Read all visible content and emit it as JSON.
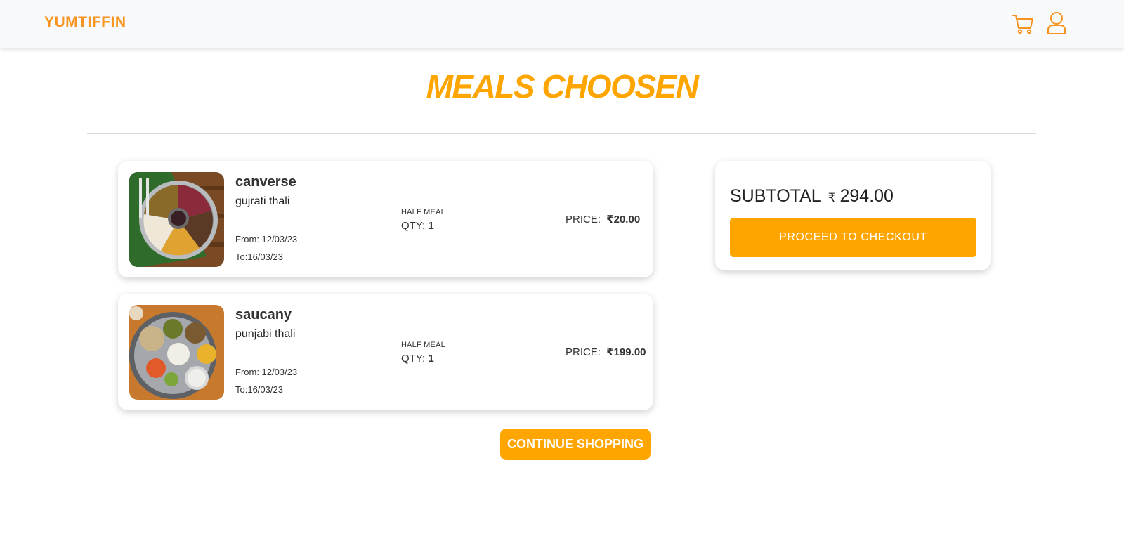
{
  "navbar": {
    "brand": "YUMTIFFIN",
    "icons": [
      "cart-icon",
      "user-icon"
    ],
    "accent": "#f7931e"
  },
  "page": {
    "title": "MEALS CHOOSEN",
    "title_color": "#ffa500"
  },
  "cart": {
    "items": [
      {
        "name": "canverse",
        "description": "gujrati thali",
        "from": "From: 12/03/23",
        "to": "To:16/03/23",
        "meal_type": "HALF MEAL",
        "qty_label": "QTY:",
        "qty": "1",
        "price_label": "PRICE:",
        "currency": "₹",
        "price": "20.00"
      },
      {
        "name": "saucany",
        "description": "punjabi thali",
        "from": "From: 12/03/23",
        "to": "To:16/03/23",
        "meal_type": "HALF MEAL",
        "qty_label": "QTY:",
        "qty": "1",
        "price_label": "PRICE:",
        "currency": "₹",
        "price": "199.00"
      }
    ],
    "continue_label": "CONTINUE SHOPPING"
  },
  "summary": {
    "subtotal_label": "SUBTOTAL",
    "currency": "₹",
    "subtotal": "294.00",
    "checkout_label": "PROCEED TO CHECKOUT"
  },
  "colors": {
    "primary": "#ffa500",
    "navbar_bg": "#f8f9fa"
  }
}
